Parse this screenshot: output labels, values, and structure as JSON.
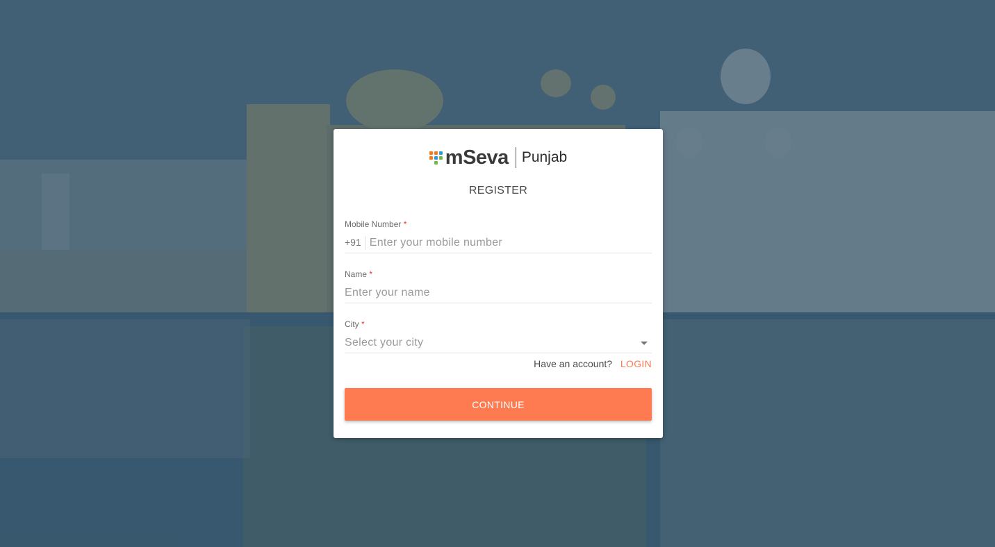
{
  "brand": {
    "name": "mSeva",
    "state": "Punjab",
    "dot_colors": [
      "#f37b21",
      "#f37b21",
      "#2e9ad6",
      "#f37b21",
      "#2e9ad6",
      "#6fba44",
      "#2e9ad6",
      "#6fba44",
      "#6fba44"
    ]
  },
  "form": {
    "title": "REGISTER",
    "mobile": {
      "label": "Mobile Number",
      "required_mark": "*",
      "prefix": "+91",
      "placeholder": "Enter your mobile number"
    },
    "name": {
      "label": "Name",
      "required_mark": "*",
      "placeholder": "Enter your name"
    },
    "city": {
      "label": "City",
      "required_mark": "*",
      "placeholder": "Select your city"
    },
    "account_prompt": "Have an account?",
    "login_link": "LOGIN",
    "continue_button": "CONTINUE"
  },
  "colors": {
    "accent": "#fe7a51",
    "required": "#e53935"
  }
}
